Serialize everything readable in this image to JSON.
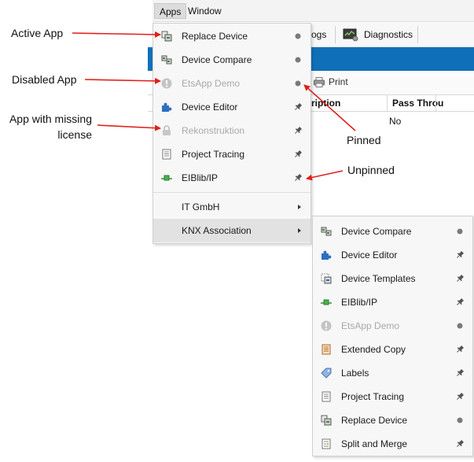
{
  "menubar": {
    "apps": "Apps",
    "window": "Window"
  },
  "toolbar": {
    "logs_fragment": "ogs",
    "diagnostics": "Diagnostics",
    "print": "Print"
  },
  "table": {
    "col_description_fragment": "ription",
    "col_pass_through_fragment": "Pass Throu",
    "cell_value": "No"
  },
  "apps_menu": {
    "items": [
      {
        "label": "Replace Device",
        "status": "pinned",
        "enabled": true
      },
      {
        "label": "Device Compare",
        "status": "pinned",
        "enabled": true
      },
      {
        "label": "EtsApp Demo",
        "status": "pinned",
        "enabled": false
      },
      {
        "label": "Device Editor",
        "status": "unpinned",
        "enabled": true
      },
      {
        "label": "Rekonstruktion",
        "status": "unpinned",
        "enabled": false
      },
      {
        "label": "Project Tracing",
        "status": "unpinned",
        "enabled": true
      },
      {
        "label": "EIBlib/IP",
        "status": "unpinned",
        "enabled": true
      }
    ],
    "submenus": [
      {
        "label": "IT GmbH"
      },
      {
        "label": "KNX Association"
      }
    ]
  },
  "knx_menu": {
    "items": [
      {
        "label": "Device Compare",
        "status": "pinned",
        "enabled": true
      },
      {
        "label": "Device Editor",
        "status": "unpinned",
        "enabled": true
      },
      {
        "label": "Device Templates",
        "status": "unpinned",
        "enabled": true
      },
      {
        "label": "EIBlib/IP",
        "status": "unpinned",
        "enabled": true
      },
      {
        "label": "EtsApp Demo",
        "status": "pinned",
        "enabled": false
      },
      {
        "label": "Extended Copy",
        "status": "unpinned",
        "enabled": true
      },
      {
        "label": "Labels",
        "status": "unpinned",
        "enabled": true
      },
      {
        "label": "Project Tracing",
        "status": "unpinned",
        "enabled": true
      },
      {
        "label": "Replace Device",
        "status": "pinned",
        "enabled": true
      },
      {
        "label": "Split and Merge",
        "status": "unpinned",
        "enabled": true
      }
    ]
  },
  "annotations": {
    "active_app": "Active App",
    "disabled_app": "Disabled App",
    "missing_license_line1": "App with missing",
    "missing_license_line2": "license",
    "pinned": "Pinned",
    "unpinned": "Unpinned"
  },
  "colors": {
    "accent_blue": "#0f70b8",
    "annotation_red": "#e0201b",
    "menu_bg": "#f7f7f7",
    "highlight_bg": "#e2e2e2",
    "disabled_text": "#a9a9a9"
  }
}
